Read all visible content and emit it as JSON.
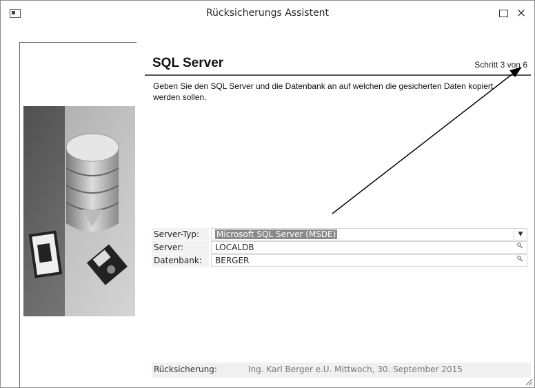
{
  "window": {
    "title": "Rücksicherungs Assistent",
    "maximize_icon": "maximize-icon",
    "close_symbol": "×"
  },
  "page": {
    "heading": "SQL Server",
    "step": "Schritt 3 von 6",
    "description": "Geben Sie den SQL Server und die Datenbank an auf welchen die gesicherten Daten kopiert werden sollen."
  },
  "form": {
    "server_type": {
      "label": "Server-Typ:",
      "value": "Microsoft SQL Server (MSDE)",
      "dropdown_icon": "▼"
    },
    "server": {
      "label": "Server:",
      "value": "LOCALDB",
      "lookup_icon": "search-icon"
    },
    "database": {
      "label": "Datenbank:",
      "value": "BERGER",
      "lookup_icon": "search-icon"
    }
  },
  "footer": {
    "label": "Rücksicherung:",
    "value": "Ing. Karl Berger e.U. Mittwoch, 30. September 2015"
  },
  "colors": {
    "selection": "#8a8a8a",
    "label_bg": "#f2f2f2",
    "rule": "#555555"
  }
}
